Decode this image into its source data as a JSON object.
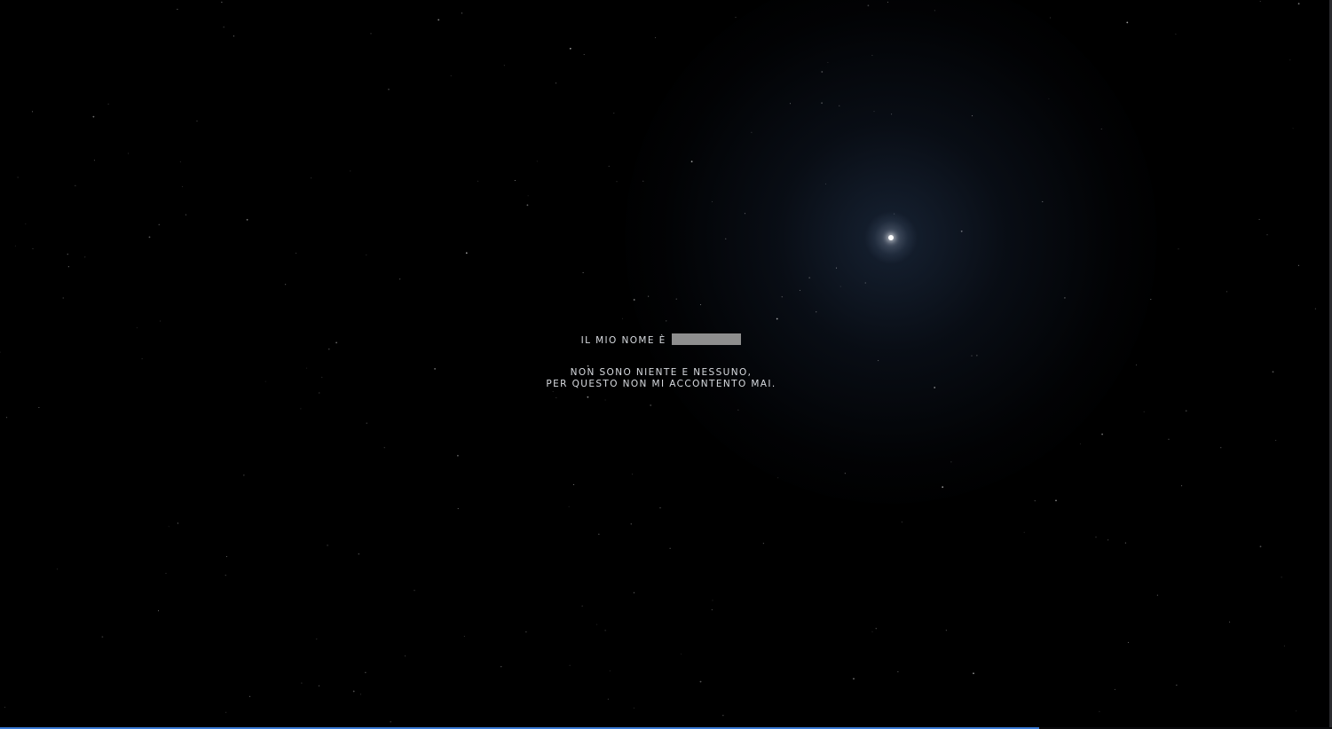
{
  "intro": {
    "name_prefix": "IL MIO NOME È",
    "tagline_line1": "NON SONO NIENTE E NESSUNO,",
    "tagline_line2": "PER QUESTO NON MI ACCONTENTO MAI."
  },
  "colors": {
    "background": "#000000",
    "text": "#d8dbe0",
    "redaction": "#8e8e8e",
    "progress": "#3a7bd5"
  },
  "progress": {
    "fraction": 0.78
  },
  "icons": {
    "star": "bright-star-icon"
  }
}
